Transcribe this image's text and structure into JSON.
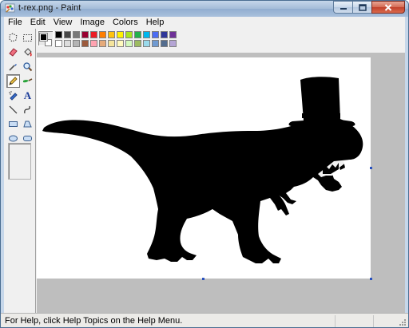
{
  "window": {
    "title": "t-rex.png - Paint",
    "buttons": {
      "minimize": "minimize",
      "maximize": "maximize",
      "close": "close"
    }
  },
  "menu": [
    "File",
    "Edit",
    "View",
    "Image",
    "Colors",
    "Help"
  ],
  "tools": [
    {
      "name": "free-form-select-icon",
      "active": false
    },
    {
      "name": "select-icon",
      "active": false
    },
    {
      "name": "eraser-icon",
      "active": false
    },
    {
      "name": "fill-bucket-icon",
      "active": false
    },
    {
      "name": "pick-color-icon",
      "active": false
    },
    {
      "name": "magnifier-icon",
      "active": false
    },
    {
      "name": "pencil-icon",
      "active": true
    },
    {
      "name": "brush-icon",
      "active": false
    },
    {
      "name": "airbrush-icon",
      "active": false
    },
    {
      "name": "text-icon",
      "active": false,
      "glyph": "A"
    },
    {
      "name": "line-icon",
      "active": false
    },
    {
      "name": "curve-icon",
      "active": false
    },
    {
      "name": "rectangle-icon",
      "active": false
    },
    {
      "name": "polygon-icon",
      "active": false
    },
    {
      "name": "ellipse-icon",
      "active": false
    },
    {
      "name": "rounded-rectangle-icon",
      "active": false
    }
  ],
  "colors": {
    "foreground": "#000000",
    "background": "#ffffff",
    "palette_top": [
      "#000000",
      "#464646",
      "#787878",
      "#990030",
      "#ed1c24",
      "#ff7e00",
      "#ffc20e",
      "#fff200",
      "#a8e61d",
      "#22b14c",
      "#00b7ef",
      "#4d6df3",
      "#2f3699",
      "#6f3198"
    ],
    "palette_bottom": [
      "#ffffff",
      "#dcdcdc",
      "#b4b4b4",
      "#9c5a3c",
      "#ffa3b1",
      "#e5aa7a",
      "#f5e49c",
      "#fff9bd",
      "#d3f9bc",
      "#9dbb61",
      "#99d9ea",
      "#709ad1",
      "#546d8e",
      "#b5a5d5"
    ]
  },
  "status": {
    "help_text": "For Help, click Help Topics on the Help Menu."
  }
}
